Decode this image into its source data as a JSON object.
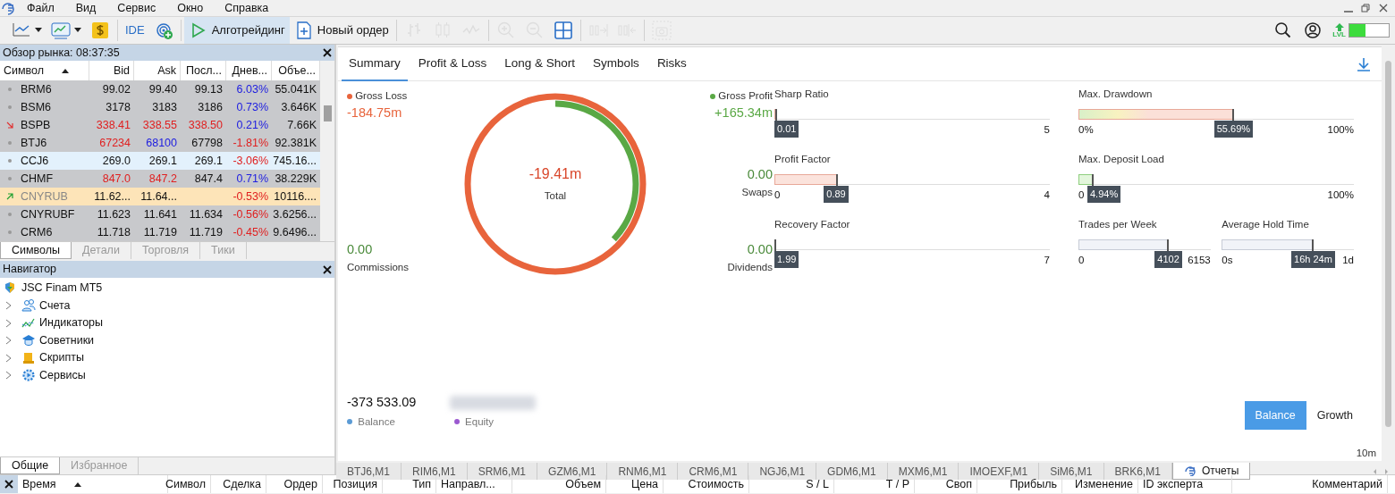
{
  "menu": [
    "Файл",
    "Вид",
    "Сервис",
    "Окно",
    "Справка"
  ],
  "toolbar": [
    {
      "kind": "linechart",
      "disabled": false,
      "caret": true,
      "selected": false
    },
    {
      "kind": "template",
      "disabled": false,
      "caret": true,
      "selected": false
    },
    {
      "kind": "dollar",
      "disabled": false,
      "caret": false,
      "selected": false
    },
    {
      "kind": "sep"
    },
    {
      "kind": "text",
      "label": "IDE",
      "disabled": false,
      "caret": false,
      "selected": false
    },
    {
      "kind": "signals",
      "disabled": false,
      "caret": false,
      "selected": false
    },
    {
      "kind": "sep"
    },
    {
      "kind": "play",
      "label": "Алготрейдинг",
      "disabled": false,
      "caret": false,
      "selected": true
    },
    {
      "kind": "order",
      "label": "Новый ордер",
      "disabled": false,
      "caret": false,
      "selected": false
    },
    {
      "kind": "sep"
    },
    {
      "kind": "bars",
      "disabled": true,
      "caret": false,
      "selected": false
    },
    {
      "kind": "candles",
      "disabled": true,
      "caret": false,
      "selected": false
    },
    {
      "kind": "line",
      "disabled": true,
      "caret": false,
      "selected": false
    },
    {
      "kind": "sep"
    },
    {
      "kind": "zoomin",
      "disabled": true,
      "caret": false,
      "selected": false
    },
    {
      "kind": "zoomout",
      "disabled": true,
      "caret": false,
      "selected": false
    },
    {
      "kind": "tile",
      "disabled": false,
      "caret": false,
      "selected": false
    },
    {
      "kind": "sep"
    },
    {
      "kind": "shift",
      "disabled": true,
      "caret": false,
      "selected": false
    },
    {
      "kind": "autoscroll",
      "disabled": true,
      "caret": false,
      "selected": false
    },
    {
      "kind": "sep"
    },
    {
      "kind": "screenshot",
      "disabled": true,
      "caret": false,
      "selected": false
    }
  ],
  "level_meter": {
    "label": "LVL",
    "level": 0.42
  },
  "market_watch": {
    "title": "Обзор рынка: 08:37:35",
    "columns": [
      "Символ",
      "Bid",
      "Ask",
      "Посл...",
      "Днев...",
      "Объе..."
    ],
    "rows": [
      {
        "kind": "dot",
        "selected": false,
        "disabled": false,
        "cells": [
          {
            "text": "BRM6"
          },
          {
            "text": "99.02",
            "color": "#111111"
          },
          {
            "text": "99.40",
            "color": "#111111"
          },
          {
            "text": "99.13",
            "color": "#111111"
          },
          {
            "text": "6.03%",
            "color": "#2020e0"
          },
          {
            "text": "55.041K",
            "color": "#111111"
          }
        ]
      },
      {
        "kind": "dot",
        "selected": false,
        "disabled": false,
        "cells": [
          {
            "text": "BSM6"
          },
          {
            "text": "3178",
            "color": "#111111"
          },
          {
            "text": "3183",
            "color": "#111111"
          },
          {
            "text": "3186",
            "color": "#111111"
          },
          {
            "text": "0.73%",
            "color": "#2020e0"
          },
          {
            "text": "3.646K",
            "color": "#111111"
          }
        ]
      },
      {
        "kind": "down",
        "selected": false,
        "disabled": false,
        "cells": [
          {
            "text": "BSPB"
          },
          {
            "text": "338.41",
            "color": "#e02020"
          },
          {
            "text": "338.55",
            "color": "#e02020"
          },
          {
            "text": "338.50",
            "color": "#e02020"
          },
          {
            "text": "0.21%",
            "color": "#2020e0"
          },
          {
            "text": "7.66K",
            "color": "#111111"
          }
        ]
      },
      {
        "kind": "dot",
        "selected": false,
        "disabled": false,
        "cells": [
          {
            "text": "BTJ6"
          },
          {
            "text": "67234",
            "color": "#e02020"
          },
          {
            "text": "68100",
            "color": "#2020e0"
          },
          {
            "text": "67798",
            "color": "#111111"
          },
          {
            "text": "-1.81%",
            "color": "#e02020"
          },
          {
            "text": "92.381K",
            "color": "#111111"
          }
        ]
      },
      {
        "kind": "dot",
        "selected": true,
        "disabled": false,
        "cells": [
          {
            "text": "CCJ6"
          },
          {
            "text": "269.0",
            "color": "#111111"
          },
          {
            "text": "269.1",
            "color": "#111111"
          },
          {
            "text": "269.1",
            "color": "#111111"
          },
          {
            "text": "-3.06%",
            "color": "#e02020"
          },
          {
            "text": "745.16...",
            "color": "#111111"
          }
        ]
      },
      {
        "kind": "dot",
        "selected": false,
        "disabled": false,
        "cells": [
          {
            "text": "CHMF"
          },
          {
            "text": "847.0",
            "color": "#e02020"
          },
          {
            "text": "847.2",
            "color": "#e02020"
          },
          {
            "text": "847.4",
            "color": "#111111"
          },
          {
            "text": "0.71%",
            "color": "#2020e0"
          },
          {
            "text": "38.229K",
            "color": "#111111"
          }
        ]
      },
      {
        "kind": "up",
        "selected": false,
        "disabled": true,
        "cells": [
          {
            "text": "CNYRUB"
          },
          {
            "text": "11.62...",
            "color": "#111111"
          },
          {
            "text": "11.64...",
            "color": "#111111"
          },
          {
            "text": ""
          },
          {
            "text": "-0.53%",
            "color": "#e02020"
          },
          {
            "text": "10116....",
            "color": "#111111"
          }
        ]
      },
      {
        "kind": "dot",
        "selected": false,
        "disabled": false,
        "cells": [
          {
            "text": "CNYRUBF"
          },
          {
            "text": "11.623",
            "color": "#111111"
          },
          {
            "text": "11.641",
            "color": "#111111"
          },
          {
            "text": "11.634",
            "color": "#111111"
          },
          {
            "text": "-0.56%",
            "color": "#e02020"
          },
          {
            "text": "3.6256...",
            "color": "#111111"
          }
        ]
      },
      {
        "kind": "dot",
        "selected": false,
        "disabled": false,
        "cells": [
          {
            "text": "CRM6"
          },
          {
            "text": "11.718",
            "color": "#111111"
          },
          {
            "text": "11.719",
            "color": "#111111"
          },
          {
            "text": "11.719",
            "color": "#111111"
          },
          {
            "text": "-0.45%",
            "color": "#e02020"
          },
          {
            "text": "9.6496...",
            "color": "#111111"
          }
        ]
      }
    ],
    "tabs": [
      {
        "label": "Символы",
        "selected": true
      },
      {
        "label": "Детали",
        "selected": false
      },
      {
        "label": "Торговля",
        "selected": false
      },
      {
        "label": "Тики",
        "selected": false
      }
    ]
  },
  "navigator": {
    "title": "Навигатор",
    "tree": [
      {
        "label": "JSC Finam MT5",
        "kind": "broker",
        "children": [
          {
            "label": "Счета",
            "kind": "accounts",
            "expanded": false
          },
          {
            "label": "Индикаторы",
            "kind": "indicators",
            "expanded": false
          },
          {
            "label": "Советники",
            "kind": "experts",
            "expanded": false
          },
          {
            "label": "Скрипты",
            "kind": "scripts",
            "expanded": false
          },
          {
            "label": "Сервисы",
            "kind": "services",
            "expanded": false
          }
        ]
      }
    ],
    "tabs": [
      {
        "label": "Общие",
        "selected": true
      },
      {
        "label": "Избранное",
        "selected": false
      }
    ]
  },
  "report": {
    "tabs": [
      {
        "label": "Summary",
        "selected": true
      },
      {
        "label": "Profit & Loss",
        "selected": false
      },
      {
        "label": "Long & Short",
        "selected": false
      },
      {
        "label": "Symbols",
        "selected": false
      },
      {
        "label": "Risks",
        "selected": false
      }
    ],
    "gross_loss": {
      "label": "Gross Loss",
      "value": "-184.75m",
      "color": "#e8643c"
    },
    "gross_profit": {
      "label": "Gross Profit",
      "value": "+165.34m",
      "color": "#5aa845"
    },
    "donut": {
      "level": 0.37
    },
    "total": {
      "value": "-19.41m",
      "label": "Total"
    },
    "swaps": {
      "value": "0.00",
      "label": "Swaps"
    },
    "commissions": {
      "value": "0.00",
      "label": "Commissions"
    },
    "dividends": {
      "value": "0.00",
      "label": "Dividends"
    },
    "metrics": [
      {
        "label": "Sharp Ratio",
        "kind": "loss",
        "level": 0.002,
        "marker": "0.01",
        "max": "5"
      },
      {
        "label": "Max. Drawdown",
        "kind": "gradient",
        "level": 0.5569,
        "marker": "55.69%",
        "min": "0%",
        "max": "100%"
      },
      {
        "label": "Profit Factor",
        "kind": "loss",
        "level": 0.2225,
        "marker": "0.89",
        "min": "0",
        "max": "4"
      },
      {
        "label": "Max. Deposit Load",
        "kind": "gain",
        "level": 0.0494,
        "marker": "4.94%",
        "min": "0",
        "max": "100%"
      },
      {
        "label": "Recovery Factor",
        "kind": "gain",
        "level": 0.0,
        "marker": "1.99",
        "max": "7"
      },
      {
        "label": "Trades per Week",
        "kind": "neutral",
        "level": 0.667,
        "marker": "4102",
        "min": "0",
        "max": "6153"
      },
      {
        "label": "Average Hold Time",
        "kind": "neutral",
        "level": 0.683,
        "marker": "16h 24m",
        "min": "0s",
        "max": "1d"
      }
    ],
    "balance_value": "-373 533.09",
    "legend": [
      {
        "label": "Balance",
        "color": "#5b9bd5"
      },
      {
        "label": "Equity",
        "color": "#9b59d0"
      }
    ],
    "toggle": [
      {
        "label": "Balance",
        "selected": true
      },
      {
        "label": "Growth",
        "selected": false
      }
    ],
    "axis_label": "10m"
  },
  "chart_tabs": [
    {
      "label": "BTJ6,M1",
      "selected": false
    },
    {
      "label": "RIM6,M1",
      "selected": false
    },
    {
      "label": "SRM6,M1",
      "selected": false
    },
    {
      "label": "GZM6,M1",
      "selected": false
    },
    {
      "label": "RNM6,M1",
      "selected": false
    },
    {
      "label": "CRM6,M1",
      "selected": false
    },
    {
      "label": "NGJ6,M1",
      "selected": false
    },
    {
      "label": "GDM6,M1",
      "selected": false
    },
    {
      "label": "MXM6,M1",
      "selected": false
    },
    {
      "label": "IMOEXF,M1",
      "selected": false
    },
    {
      "label": "SiM6,M1",
      "selected": false
    },
    {
      "label": "BRK6,M1",
      "selected": false
    },
    {
      "label": "Отчеты",
      "selected": true,
      "kind": "reports"
    }
  ],
  "trade_columns": [
    {
      "label": "Время",
      "sorted": true
    },
    {
      "label": "Символ",
      "sorted": false
    },
    {
      "label": "Сделка",
      "sorted": false
    },
    {
      "label": "Ордер",
      "sorted": false
    },
    {
      "label": "Позиция",
      "sorted": false
    },
    {
      "label": "Тип",
      "sorted": false
    },
    {
      "label": "Направл...",
      "sorted": false
    },
    {
      "label": "Объем",
      "sorted": false
    },
    {
      "label": "Цена",
      "sorted": false
    },
    {
      "label": "Стоимость",
      "sorted": false
    },
    {
      "label": "S / L",
      "sorted": false
    },
    {
      "label": "T / P",
      "sorted": false
    },
    {
      "label": "Своп",
      "sorted": false
    },
    {
      "label": "Прибыль",
      "sorted": false
    },
    {
      "label": "Изменение",
      "sorted": false
    },
    {
      "label": "ID эксперта",
      "sorted": false
    },
    {
      "label": "Комментарий",
      "sorted": false
    }
  ]
}
